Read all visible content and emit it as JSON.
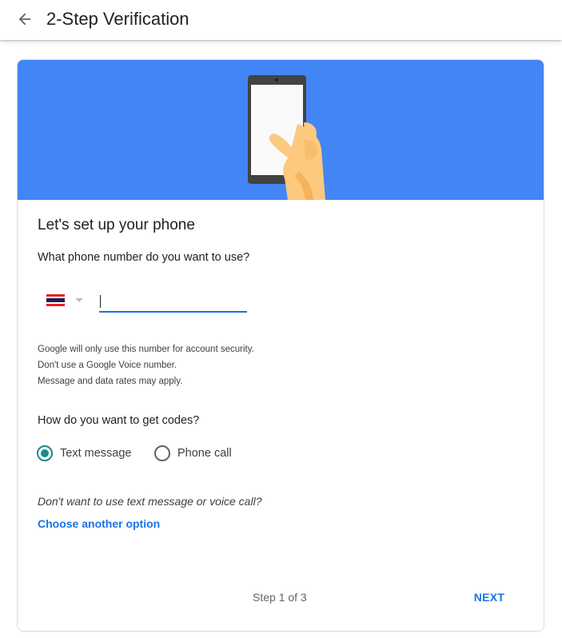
{
  "header": {
    "title": "2-Step Verification",
    "back_icon": "arrow-back-icon"
  },
  "banner": {
    "background_color": "#4285f4",
    "illustration": "hand-holding-phone-illustration"
  },
  "setup": {
    "heading": "Let's set up your phone",
    "phone_question": "What phone number do you want to use?",
    "country": {
      "flag_icon": "thailand-flag-icon",
      "dropdown_icon": "dropdown-arrow-icon"
    },
    "phone_input": {
      "value": "",
      "placeholder": ""
    },
    "info_lines": [
      "Google will only use this number for account security.",
      "Don't use a Google Voice number.",
      "Message and data rates may apply."
    ]
  },
  "codes": {
    "question": "How do you want to get codes?",
    "options": [
      {
        "label": "Text message",
        "selected": true
      },
      {
        "label": "Phone call",
        "selected": false
      }
    ]
  },
  "alternative": {
    "question": "Don't want to use text message or voice call?",
    "link_label": "Choose another option"
  },
  "footer": {
    "step_text": "Step 1 of 3",
    "next_label": "NEXT"
  },
  "colors": {
    "accent": "#1a73e8",
    "radio_selected": "#1a8b89",
    "banner": "#4285f4"
  }
}
